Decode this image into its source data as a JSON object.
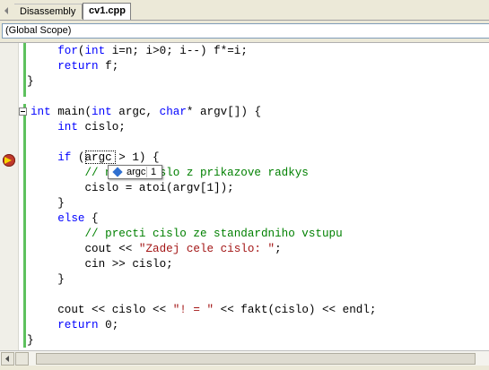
{
  "tabs": [
    {
      "label": "Disassembly",
      "active": false
    },
    {
      "label": "cv1.cpp",
      "active": true
    }
  ],
  "scope": {
    "value": "(Global Scope)"
  },
  "code": {
    "l0": {
      "a": "    ",
      "b": "for",
      "c": "(",
      "d": "int",
      "e": " i=n; i>0; i--) f*=i;"
    },
    "l1": {
      "a": "    ",
      "b": "return",
      "c": " f;"
    },
    "l2": {
      "a": "}"
    },
    "l4": {
      "a": "int",
      "b": " main(",
      "c": "int",
      "d": " argc, ",
      "e": "char",
      "f": "* argv[]) {"
    },
    "l5": {
      "a": "    ",
      "b": "int",
      "c": " cislo;"
    },
    "l7": {
      "a": "    ",
      "b": "if",
      "c": " (argc > 1) {"
    },
    "l8": {
      "a": "        ",
      "b": "// nacti cislo z prikazove radkys"
    },
    "l9": {
      "a": "        cislo = atoi(argv[1]);"
    },
    "l10": {
      "a": "    }"
    },
    "l11": {
      "a": "    ",
      "b": "else",
      "c": " {"
    },
    "l12": {
      "a": "        ",
      "b": "// precti cislo ze standardniho vstupu"
    },
    "l13": {
      "a": "        cout << ",
      "b": "\"Zadej cele cislo: \"",
      "c": ";"
    },
    "l14": {
      "a": "        cin >> cislo;"
    },
    "l15": {
      "a": "    }"
    },
    "l17": {
      "a": "    cout << cislo << ",
      "b": "\"! = \"",
      "c": " << fakt(cislo) << endl;"
    },
    "l18": {
      "a": "    ",
      "b": "return",
      "c": " 0;"
    },
    "l19": {
      "a": "}"
    }
  },
  "datatip": {
    "name": "argc",
    "value": "1"
  },
  "colors": {
    "keyword": "#0000ff",
    "comment": "#008000",
    "string": "#a31515",
    "changed_bar": "#5ec15e"
  }
}
